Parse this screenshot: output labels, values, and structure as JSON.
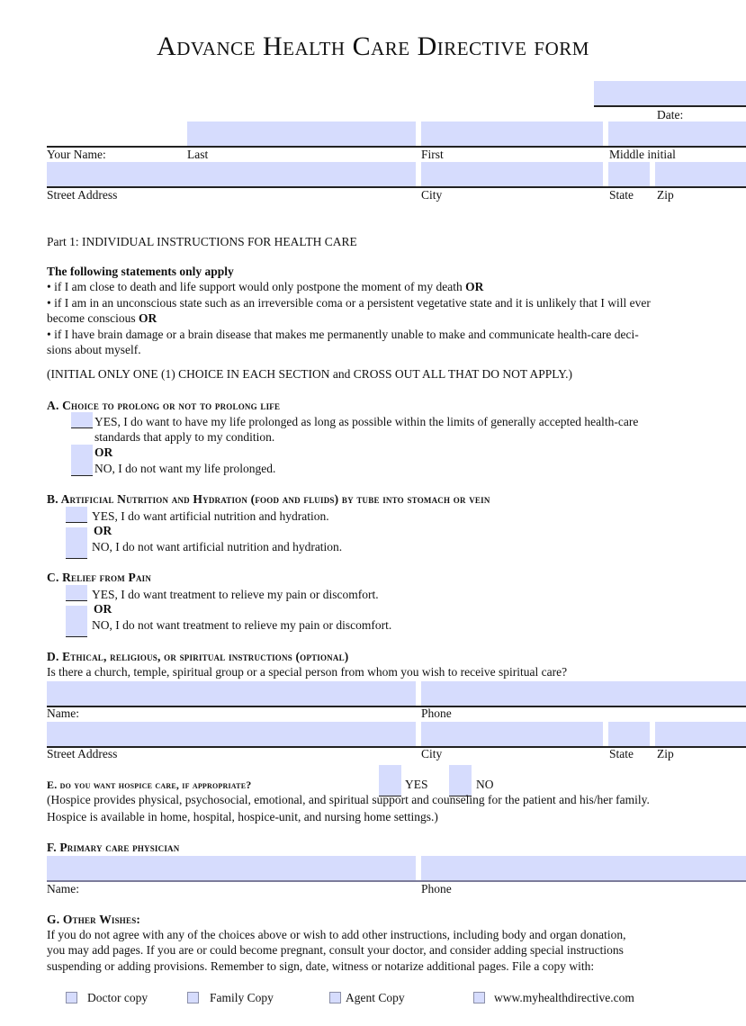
{
  "title": "Advance Health Care Directive form",
  "header": {
    "date_label": "Date:",
    "date_value": "",
    "your_name_label": "Your Name:",
    "last_label": "Last",
    "first_label": "First",
    "middle_label": "Middle initial",
    "street_label": "Street Address",
    "city_label": "City",
    "state_label": "State",
    "zip_label": "Zip",
    "last_value": "",
    "first_value": "",
    "middle_value": "",
    "street_value": "",
    "city_value": "",
    "state_value": "",
    "zip_value": ""
  },
  "part1": {
    "heading": "Part 1: INDIVIDUAL INSTRUCTIONS FOR HEALTH CARE",
    "statements_heading": "The following statements only apply",
    "bullet1": "• if I am close to death and life support would only postpone the moment of my death ",
    "bullet2a": "• if I am in an unconscious state such as an irreversible coma or a persistent vegetative state and it is unlikely that I will ever",
    "bullet2b": "become conscious ",
    "bullet3a": "• if I have brain damage or a brain disease that makes me permanently unable to make and communicate health-care deci-",
    "bullet3b": "sions about myself.",
    "or": "OR",
    "instruction": "(INITIAL ONLY ONE (1) CHOICE IN EACH SECTION and CROSS OUT ALL THAT DO NOT APPLY.)"
  },
  "sectionA": {
    "heading": "A. Choice to prolong or not to prolong life",
    "yes_a": "YES, I do want to have my life prolonged as long as possible within the limits of generally accepted health-care",
    "yes_b": "standards that apply to my condition.",
    "or": "OR",
    "no": "NO, I do not want my life prolonged."
  },
  "sectionB": {
    "heading": "B. Artificial Nutrition and Hydration (food and fluids) by tube into stomach or vein",
    "yes": "YES, I do want artificial nutrition and hydration.",
    "or": "OR",
    "no": "NO, I do not want artificial nutrition and hydration."
  },
  "sectionC": {
    "heading": "C. Relief from Pain",
    "yes": "YES, I do want treatment to relieve my pain or discomfort.",
    "or": "OR",
    "no": "NO, I do not want treatment to relieve my pain or discomfort."
  },
  "sectionD": {
    "heading": "D. Ethical, religious, or spiritual instructions (optional)",
    "question": "Is there a church, temple, spiritual group or a special person from whom you wish to receive spiritual care?",
    "name_label": "Name:",
    "phone_label": "Phone",
    "street_label": "Street Address",
    "city_label": "City",
    "state_label": "State",
    "zip_label": "Zip"
  },
  "sectionE": {
    "heading": "E.  do you want hospice care, if appropriate?",
    "yes": "YES",
    "no": "NO",
    "note_a": "(Hospice provides physical, psychosocial, emotional, and spiritual support and counseling for the patient and his/her family.",
    "note_b": "Hospice is available in home, hospital, hospice-unit, and nursing home settings.)"
  },
  "sectionF": {
    "heading": "F. Primary care physician",
    "name_label": "Name:",
    "phone_label": "Phone"
  },
  "sectionG": {
    "heading": "G. Other Wishes:",
    "text_a": "If you do not agree with any of the choices above or wish to add other instructions, including body and organ donation,",
    "text_b": "you may add pages. If you are or could become pregnant, consult your doctor, and consider adding special instructions",
    "text_c": "suspending or adding provisions.  Remember to sign, date, witness or notarize additional pages.  File a copy with:",
    "copies": [
      {
        "label": "Doctor copy",
        "checked": false
      },
      {
        "label": "Family Copy",
        "checked": false
      },
      {
        "label": "Agent Copy",
        "checked": false
      },
      {
        "label": "www.myhealthdirective.com",
        "checked": false
      }
    ]
  },
  "colors": {
    "field_fill": "#d6dcfd",
    "text": "#111111"
  }
}
